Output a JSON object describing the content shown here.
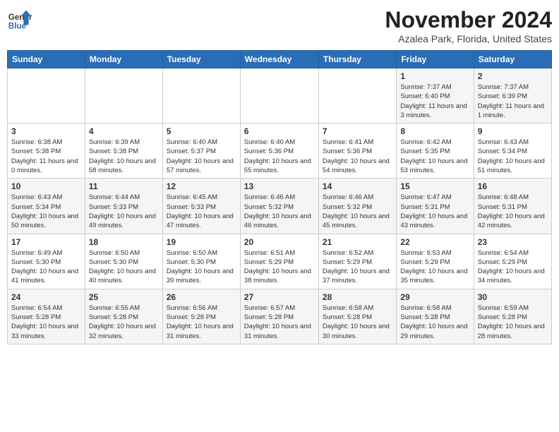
{
  "header": {
    "logo_line1": "General",
    "logo_line2": "Blue",
    "title": "November 2024",
    "subtitle": "Azalea Park, Florida, United States"
  },
  "weekdays": [
    "Sunday",
    "Monday",
    "Tuesday",
    "Wednesday",
    "Thursday",
    "Friday",
    "Saturday"
  ],
  "weeks": [
    [
      {
        "day": "",
        "text": ""
      },
      {
        "day": "",
        "text": ""
      },
      {
        "day": "",
        "text": ""
      },
      {
        "day": "",
        "text": ""
      },
      {
        "day": "",
        "text": ""
      },
      {
        "day": "1",
        "text": "Sunrise: 7:37 AM\nSunset: 6:40 PM\nDaylight: 11 hours and 3 minutes."
      },
      {
        "day": "2",
        "text": "Sunrise: 7:37 AM\nSunset: 6:39 PM\nDaylight: 11 hours and 1 minute."
      }
    ],
    [
      {
        "day": "3",
        "text": "Sunrise: 6:38 AM\nSunset: 5:38 PM\nDaylight: 11 hours and 0 minutes."
      },
      {
        "day": "4",
        "text": "Sunrise: 6:39 AM\nSunset: 5:38 PM\nDaylight: 10 hours and 58 minutes."
      },
      {
        "day": "5",
        "text": "Sunrise: 6:40 AM\nSunset: 5:37 PM\nDaylight: 10 hours and 57 minutes."
      },
      {
        "day": "6",
        "text": "Sunrise: 6:40 AM\nSunset: 5:36 PM\nDaylight: 10 hours and 55 minutes."
      },
      {
        "day": "7",
        "text": "Sunrise: 6:41 AM\nSunset: 5:36 PM\nDaylight: 10 hours and 54 minutes."
      },
      {
        "day": "8",
        "text": "Sunrise: 6:42 AM\nSunset: 5:35 PM\nDaylight: 10 hours and 53 minutes."
      },
      {
        "day": "9",
        "text": "Sunrise: 6:43 AM\nSunset: 5:34 PM\nDaylight: 10 hours and 51 minutes."
      }
    ],
    [
      {
        "day": "10",
        "text": "Sunrise: 6:43 AM\nSunset: 5:34 PM\nDaylight: 10 hours and 50 minutes."
      },
      {
        "day": "11",
        "text": "Sunrise: 6:44 AM\nSunset: 5:33 PM\nDaylight: 10 hours and 49 minutes."
      },
      {
        "day": "12",
        "text": "Sunrise: 6:45 AM\nSunset: 5:33 PM\nDaylight: 10 hours and 47 minutes."
      },
      {
        "day": "13",
        "text": "Sunrise: 6:46 AM\nSunset: 5:32 PM\nDaylight: 10 hours and 46 minutes."
      },
      {
        "day": "14",
        "text": "Sunrise: 6:46 AM\nSunset: 5:32 PM\nDaylight: 10 hours and 45 minutes."
      },
      {
        "day": "15",
        "text": "Sunrise: 6:47 AM\nSunset: 5:31 PM\nDaylight: 10 hours and 43 minutes."
      },
      {
        "day": "16",
        "text": "Sunrise: 6:48 AM\nSunset: 5:31 PM\nDaylight: 10 hours and 42 minutes."
      }
    ],
    [
      {
        "day": "17",
        "text": "Sunrise: 6:49 AM\nSunset: 5:30 PM\nDaylight: 10 hours and 41 minutes."
      },
      {
        "day": "18",
        "text": "Sunrise: 6:50 AM\nSunset: 5:30 PM\nDaylight: 10 hours and 40 minutes."
      },
      {
        "day": "19",
        "text": "Sunrise: 6:50 AM\nSunset: 5:30 PM\nDaylight: 10 hours and 39 minutes."
      },
      {
        "day": "20",
        "text": "Sunrise: 6:51 AM\nSunset: 5:29 PM\nDaylight: 10 hours and 38 minutes."
      },
      {
        "day": "21",
        "text": "Sunrise: 6:52 AM\nSunset: 5:29 PM\nDaylight: 10 hours and 37 minutes."
      },
      {
        "day": "22",
        "text": "Sunrise: 6:53 AM\nSunset: 5:29 PM\nDaylight: 10 hours and 35 minutes."
      },
      {
        "day": "23",
        "text": "Sunrise: 6:54 AM\nSunset: 5:29 PM\nDaylight: 10 hours and 34 minutes."
      }
    ],
    [
      {
        "day": "24",
        "text": "Sunrise: 6:54 AM\nSunset: 5:28 PM\nDaylight: 10 hours and 33 minutes."
      },
      {
        "day": "25",
        "text": "Sunrise: 6:55 AM\nSunset: 5:28 PM\nDaylight: 10 hours and 32 minutes."
      },
      {
        "day": "26",
        "text": "Sunrise: 6:56 AM\nSunset: 5:28 PM\nDaylight: 10 hours and 31 minutes."
      },
      {
        "day": "27",
        "text": "Sunrise: 6:57 AM\nSunset: 5:28 PM\nDaylight: 10 hours and 31 minutes."
      },
      {
        "day": "28",
        "text": "Sunrise: 6:58 AM\nSunset: 5:28 PM\nDaylight: 10 hours and 30 minutes."
      },
      {
        "day": "29",
        "text": "Sunrise: 6:58 AM\nSunset: 5:28 PM\nDaylight: 10 hours and 29 minutes."
      },
      {
        "day": "30",
        "text": "Sunrise: 6:59 AM\nSunset: 5:28 PM\nDaylight: 10 hours and 28 minutes."
      }
    ]
  ]
}
